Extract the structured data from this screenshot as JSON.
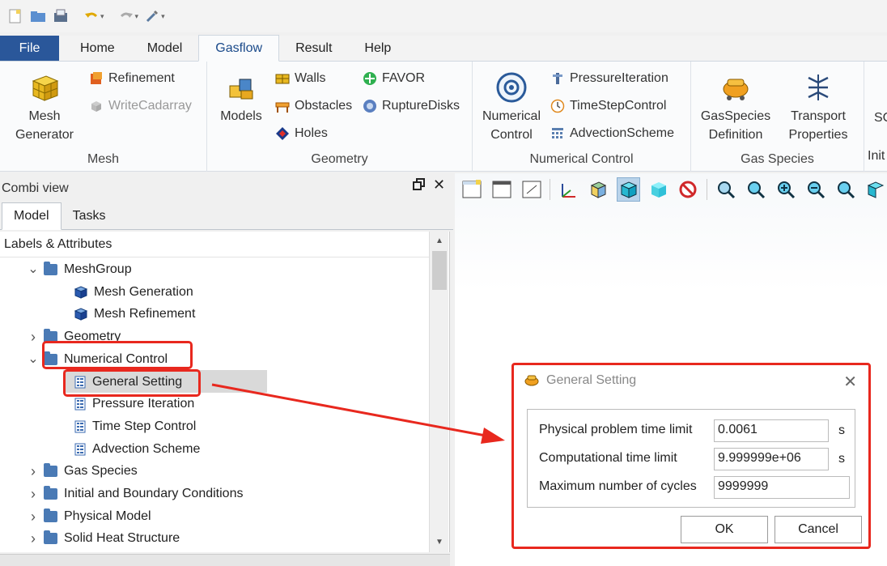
{
  "ribbon_tabs": [
    "File",
    "Home",
    "Model",
    "Gasflow",
    "Result",
    "Help"
  ],
  "active_tab": "Gasflow",
  "groups": {
    "mesh": {
      "label": "Mesh",
      "big": [
        "Mesh",
        "Generator"
      ],
      "items": [
        "Refinement",
        "WriteCadarray"
      ]
    },
    "geometry": {
      "label": "Geometry",
      "big": "Models",
      "items": [
        "Walls",
        "Obstacles",
        "Holes",
        "FAVOR",
        "RuptureDisks"
      ]
    },
    "numerical": {
      "label": "Numerical Control",
      "big": [
        "Numerical",
        "Control"
      ],
      "items": [
        "PressureIteration",
        "TimeStepControl",
        "AdvectionScheme"
      ]
    },
    "gas": {
      "label": "Gas Species",
      "big1": [
        "GasSpecies",
        "Definition"
      ],
      "big2": [
        "Transport",
        "Properties"
      ]
    },
    "cut": {
      "top": "SC",
      "label": "Init"
    }
  },
  "combi": {
    "title": "Combi view",
    "tabs": [
      "Model",
      "Tasks"
    ],
    "header": "Labels & Attributes",
    "tree": [
      {
        "label": "MeshGroup",
        "level": 1,
        "type": "folder",
        "expanded": true
      },
      {
        "label": "Mesh Generation",
        "level": 2,
        "type": "cube"
      },
      {
        "label": "Mesh Refinement",
        "level": 2,
        "type": "cube"
      },
      {
        "label": "Geometry",
        "level": 1,
        "type": "folder",
        "expanded": false
      },
      {
        "label": "Numerical Control",
        "level": 1,
        "type": "folder",
        "expanded": true
      },
      {
        "label": "General Setting",
        "level": 2,
        "type": "list",
        "selected": true
      },
      {
        "label": "Pressure Iteration",
        "level": 2,
        "type": "list"
      },
      {
        "label": "Time Step Control",
        "level": 2,
        "type": "list"
      },
      {
        "label": "Advection Scheme",
        "level": 2,
        "type": "list"
      },
      {
        "label": "Gas Species",
        "level": 1,
        "type": "folder",
        "expanded": false
      },
      {
        "label": "Initial and Boundary Conditions",
        "level": 1,
        "type": "folder",
        "expanded": false
      },
      {
        "label": "Physical Model",
        "level": 1,
        "type": "folder",
        "expanded": false
      },
      {
        "label": "Solid Heat Structure",
        "level": 1,
        "type": "folder",
        "expanded": false
      }
    ]
  },
  "dialog": {
    "title": "General Setting",
    "fields": [
      {
        "label": "Physical problem time limit",
        "value": "0.0061",
        "unit": "s"
      },
      {
        "label": "Computational time limit",
        "value": "9.999999e+06",
        "unit": "s"
      },
      {
        "label": "Maximum number of cycles",
        "value": "9999999",
        "unit": ""
      }
    ],
    "ok": "OK",
    "cancel": "Cancel"
  },
  "colors": {
    "file_tab": "#2a579a",
    "annotation": "#e8281e",
    "selection": "#d9d9d9"
  }
}
